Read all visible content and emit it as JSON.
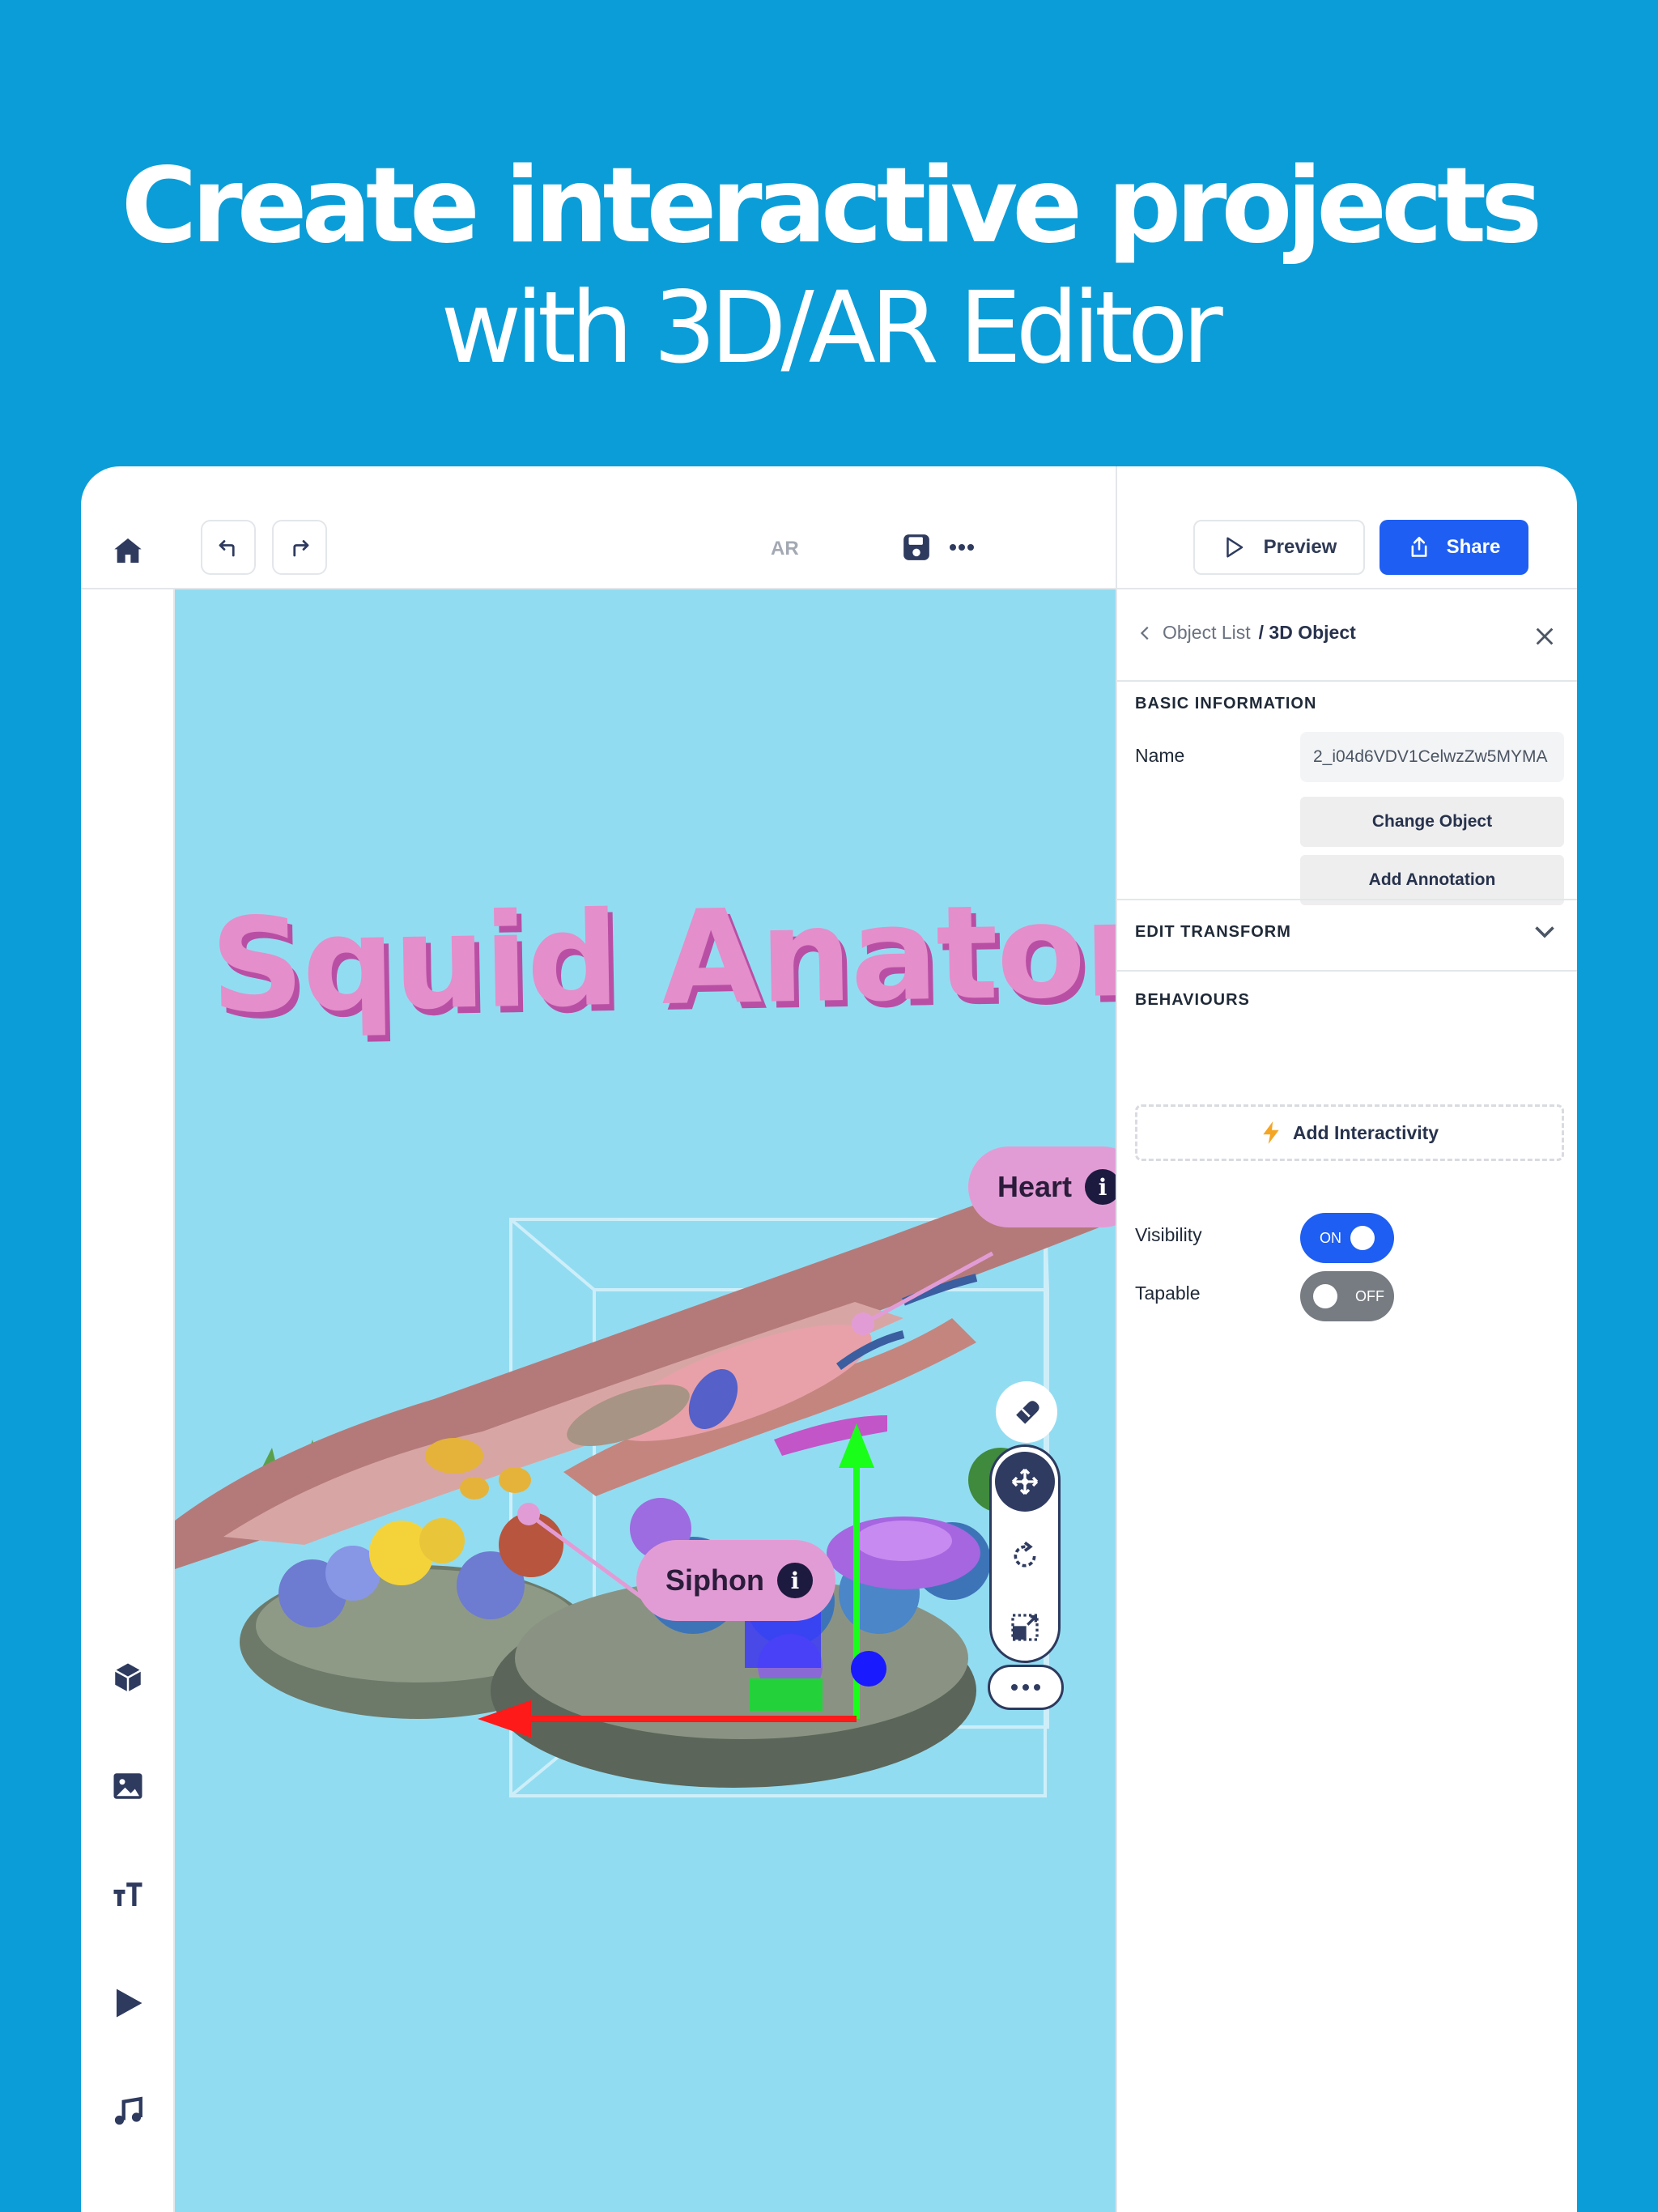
{
  "headline": {
    "line1": "Create interactive projects",
    "line2": "with 3D/AR Editor"
  },
  "topbar": {
    "mode_label": "AR",
    "preview_label": "Preview",
    "share_label": "Share",
    "icons": [
      "home-icon",
      "undo-icon",
      "redo-icon",
      "save-icon",
      "more-icon"
    ]
  },
  "rail": {
    "items": [
      "cube-icon",
      "image-icon",
      "text-icon",
      "play-icon",
      "music-icon"
    ]
  },
  "canvas": {
    "title_text": "Squid Anatomy",
    "annotations": [
      {
        "label": "Heart",
        "icon": "i"
      },
      {
        "label": "Siphon",
        "icon": "i"
      }
    ],
    "tools": [
      "magnet-icon",
      "move-icon",
      "rotate-icon",
      "scale-icon",
      "more-icon"
    ]
  },
  "panel": {
    "breadcrumb_parent": "Object List",
    "breadcrumb_current": "/ 3D Object",
    "basic_info_title": "BASIC INFORMATION",
    "name_label": "Name",
    "name_value": "2_i04d6VDV1CelwzZw5MYMA",
    "change_object_label": "Change Object",
    "add_annotation_label": "Add Annotation",
    "edit_transform_title": "EDIT TRANSFORM",
    "behaviours_title": "BEHAVIOURS",
    "add_interactivity_label": "Add Interactivity",
    "visibility_label": "Visibility",
    "visibility_state": "ON",
    "tapable_label": "Tapable",
    "tapable_state": "OFF"
  },
  "colors": {
    "background": "#0b9dd8",
    "canvas": "#92dcf1",
    "primary": "#1e5ef2",
    "annotation_pill": "#e29cd5",
    "title_text": "#e48ecb",
    "axis_x": "#ff1a1a",
    "axis_y": "#1aff1a",
    "axis_z": "#1a1aff"
  }
}
